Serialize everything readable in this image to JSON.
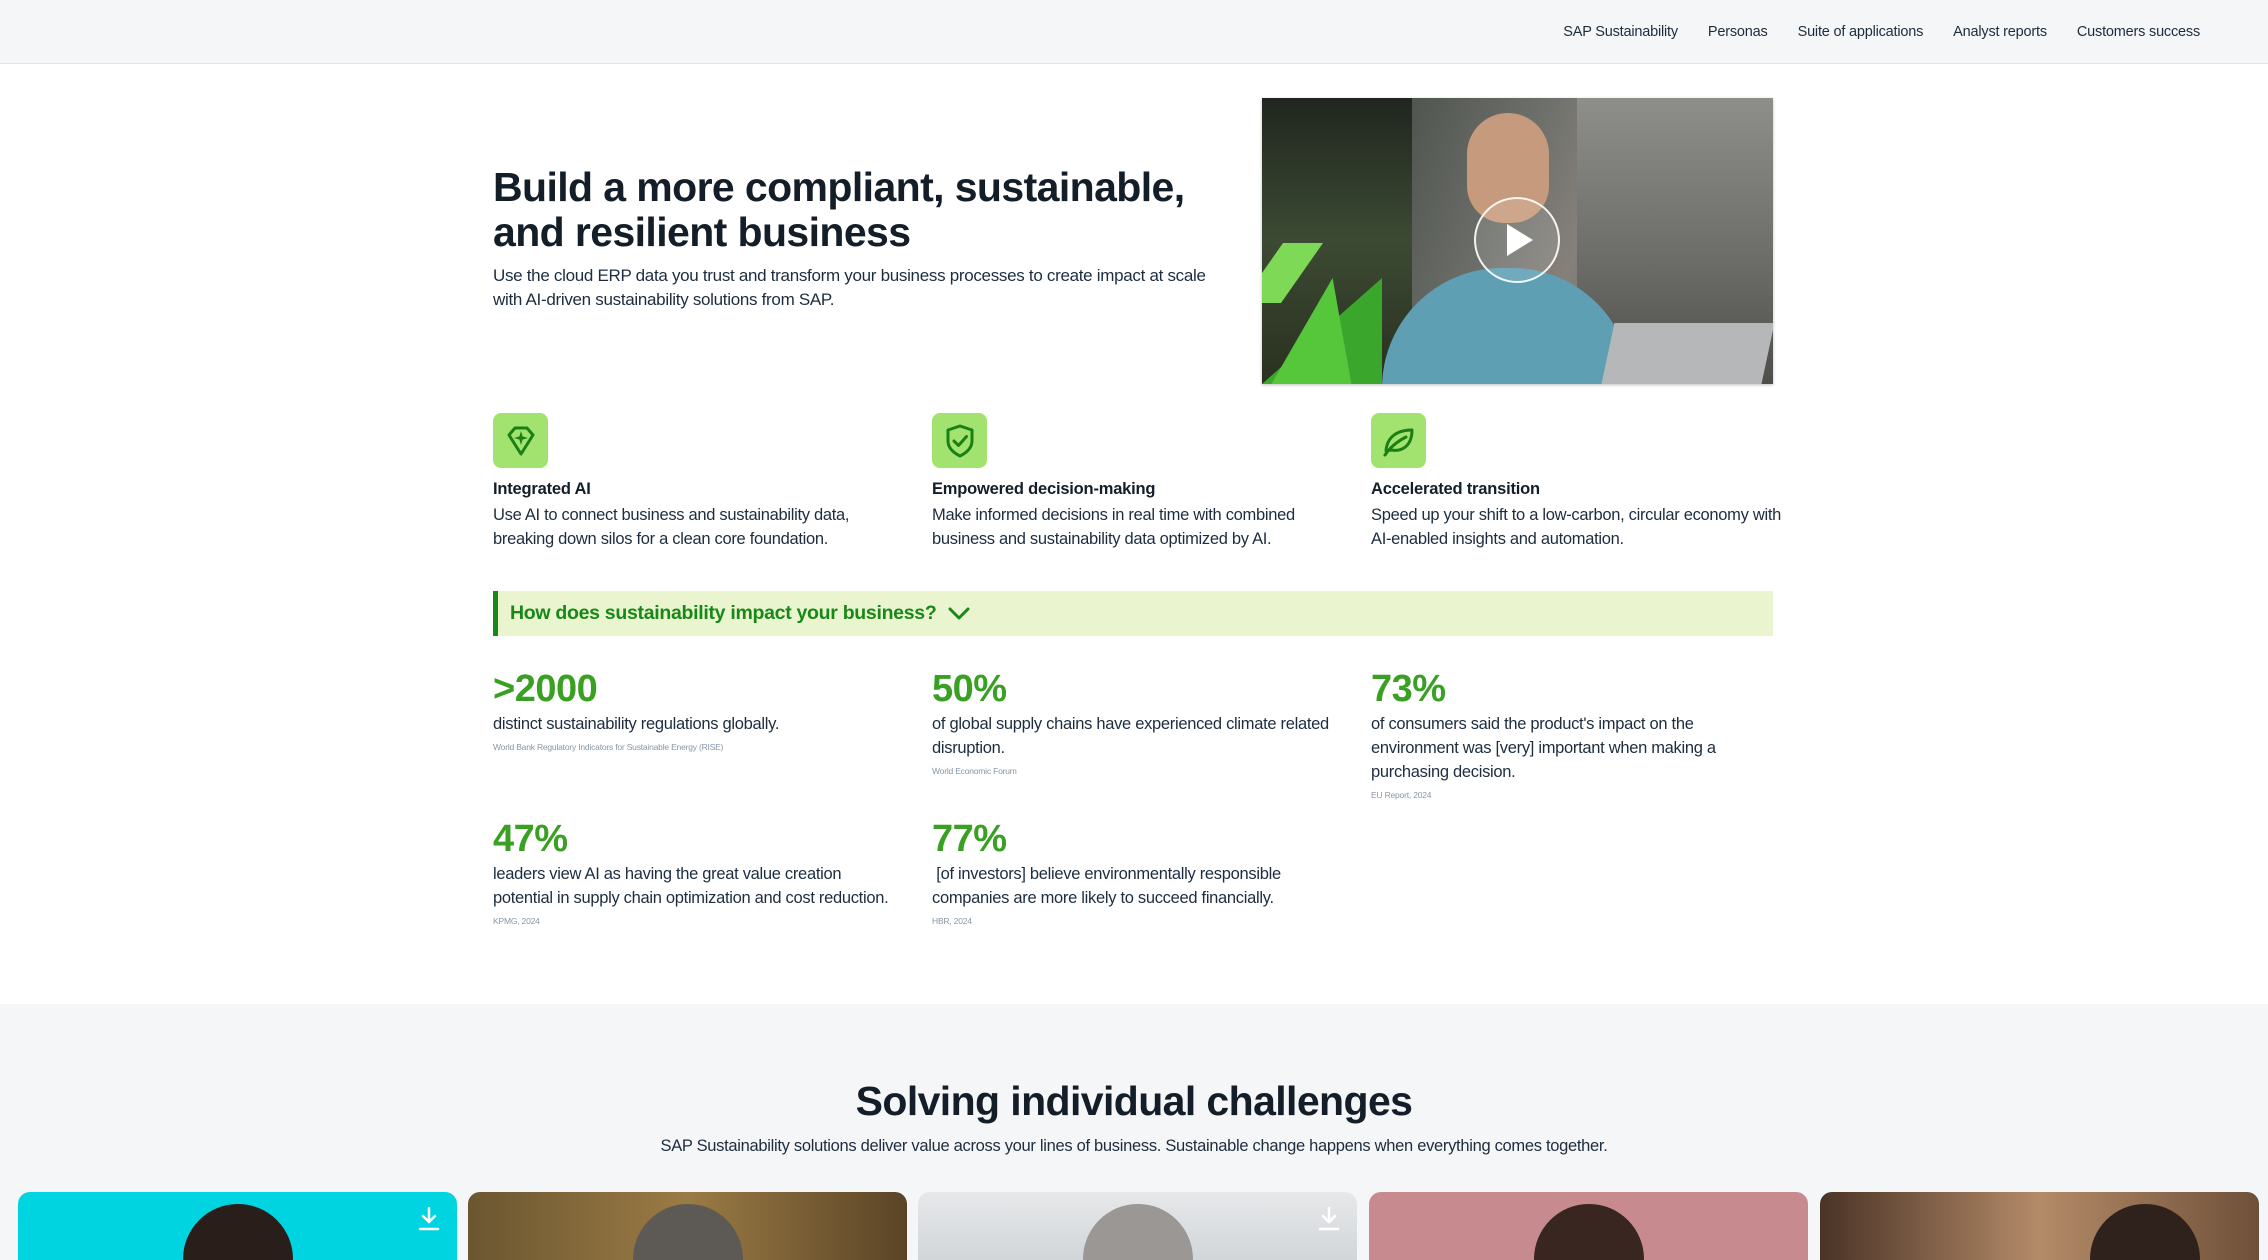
{
  "nav": {
    "items": [
      "SAP Sustainability",
      "Personas",
      "Suite of applications",
      "Analyst reports",
      "Customers success"
    ]
  },
  "hero": {
    "title": "Build a more compliant, sustainable, and resilient business",
    "subtitle": "Use the cloud ERP data you trust and transform your business processes to create impact at scale with AI-driven sustainability solutions from SAP.",
    "video_icon": "play-icon"
  },
  "features": [
    {
      "icon": "diamond-sparkle-icon",
      "title": "Integrated AI",
      "text": "Use AI to connect business and sustainability data, breaking down silos for a clean core foundation."
    },
    {
      "icon": "shield-check-icon",
      "title": "Empowered decision-making",
      "text": "Make informed decisions in real time with combined business and sustainability data optimized by AI."
    },
    {
      "icon": "leaf-icon",
      "title": "Accelerated transition",
      "text": "Speed up your shift to a low-carbon, circular economy with AI-enabled insights and automation."
    }
  ],
  "accordion": {
    "label": "How does sustainability impact your business?",
    "icon": "chevron-down-icon"
  },
  "stats": [
    {
      "value": ">2000",
      "text": "distinct sustainability regulations globally.",
      "source": "World Bank Regulatory Indicators for Sustainable Energy (RISE)"
    },
    {
      "value": "50%",
      "text": "of global supply chains have experienced climate related disruption.",
      "source": "World Economic Forum"
    },
    {
      "value": "73%",
      "text": "of consumers said the product's impact on the environment was [very] important when making a purchasing decision.",
      "source": "EU Report, 2024"
    },
    {
      "value": "47%",
      "text": "leaders view AI as having the great value creation potential in supply chain optimization and cost reduction.",
      "source": "KPMG, 2024"
    },
    {
      "value": "77%",
      "text": " [of investors] believe environmentally responsible companies are more likely to succeed financially.",
      "source": "HBR, 2024"
    }
  ],
  "challenges": {
    "title": "Solving individual challenges",
    "subtitle": "SAP Sustainability solutions deliver value across your lines of business. Sustainable change happens when everything comes together.",
    "download_icon": "download-icon"
  },
  "colors": {
    "accent_green": "#3aa024",
    "accordion_bg": "#eaf5cf",
    "accordion_text": "#188918",
    "icon_bg": "#a2e370",
    "section_bg": "#f5f6f7"
  }
}
